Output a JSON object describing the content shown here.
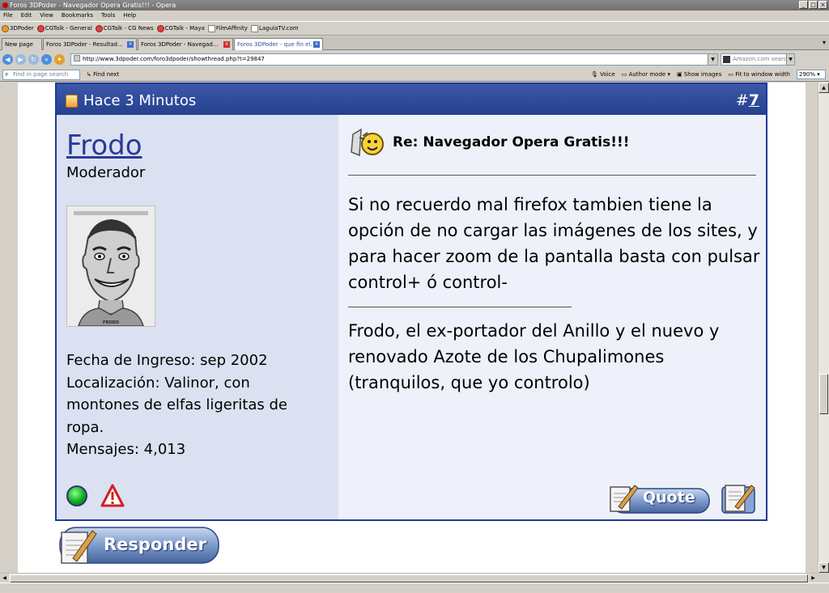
{
  "window": {
    "title": "Foros 3DPoder - Navegador Opera Gratis!!! - Opera"
  },
  "menu": [
    "File",
    "Edit",
    "View",
    "Bookmarks",
    "Tools",
    "Help"
  ],
  "bookmarks": [
    "3DPoder",
    "CGTalk - General",
    "CGTalk - CG News",
    "CGTalk - Maya",
    "FilmAffinity",
    "LaguiaTV.com"
  ],
  "tabs": [
    {
      "label": "New page"
    },
    {
      "label": "Foros 3DPoder - Resultad..."
    },
    {
      "label": "Foros 3DPoder - Navegad..."
    },
    {
      "label": "Foros 3DPoder - que fin el..."
    }
  ],
  "address": {
    "url": "http://www.3dpoder.com/foro3dpoder/showthread.php?t=29847",
    "search_placeholder": "Amazon.com search"
  },
  "findbar": {
    "placeholder": "Find in page search",
    "find_next": "Find next",
    "voice": "Voice",
    "author_mode": "Author mode",
    "show_images": "Show images",
    "fit_width": "Fit to window width",
    "zoom": "290%"
  },
  "post": {
    "when": "Hace 3 Minutos",
    "number_prefix": "#",
    "number": "7",
    "author": {
      "name": "Frodo",
      "title": "Moderador",
      "joined": "Fecha de Ingreso: sep 2002",
      "location": "Localización: Valinor, con montones de elfas ligeritas de ropa.",
      "posts": "Mensajes: 4,013",
      "avatar_caption": "FRODO"
    },
    "subject": "Re: Navegador Opera Gratis!!!",
    "body": "Si no recuerdo mal firefox tambien tiene la opción de no cargar las imágenes de los sites, y para hacer zoom de la pantalla basta con pulsar control+ ó control-",
    "signature": "Frodo, el ex-portador del Anillo y el nuevo y renovado Azote de los Chupalimones (tranquilos, que yo controlo)",
    "quote_label": "Quote"
  },
  "reply_label": "Responder"
}
